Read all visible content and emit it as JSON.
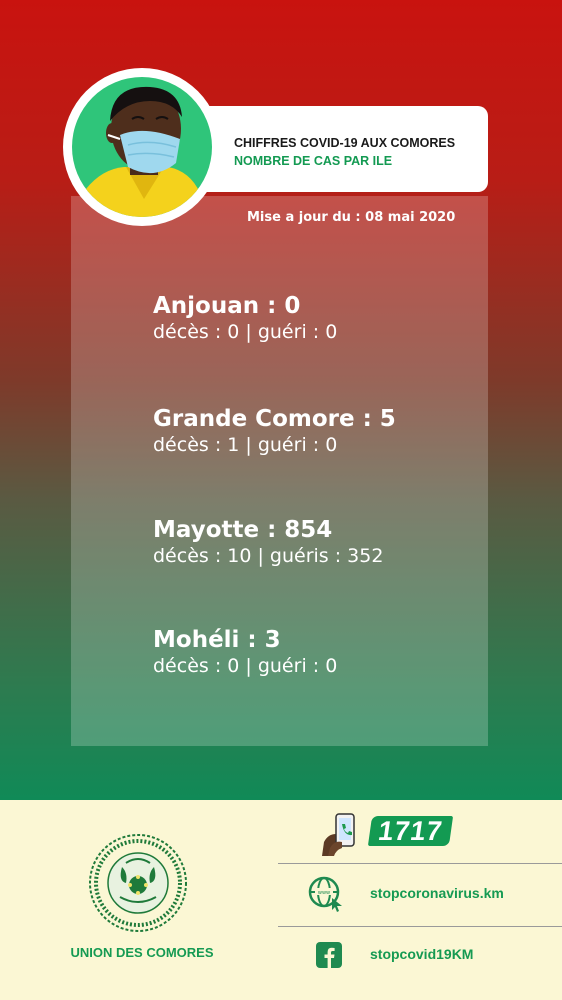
{
  "header": {
    "title": "CHIFFRES COVID-19 AUX COMORES",
    "subtitle": "NOMBRE DE CAS PAR ILE"
  },
  "update_text": "Mise a jour du : 08 mai 2020",
  "islands": [
    {
      "name": "Anjouan : 0",
      "details": "décès : 0  | guéri : 0"
    },
    {
      "name": "Grande Comore : 5",
      "details": "décès : 1  | guéri : 0"
    },
    {
      "name": "Mayotte : 854",
      "details": "décès : 10  | guéris : 352"
    },
    {
      "name": "Mohéli : 3",
      "details": "décès : 0  | guéri : 0"
    }
  ],
  "footer": {
    "org_name": "UNION DES COMORES",
    "seal_text": "UNION DES COMORES",
    "hotline": "1717",
    "website": "stopcoronavirus.km",
    "facebook": "stopcovid19KM"
  },
  "colors": {
    "top_red": "#c9130f",
    "bottom_green": "#108a57",
    "accent_green": "#139a52",
    "footer_bg": "#fbf7d4"
  },
  "icons": [
    "masked-person-illustration",
    "phone-hand-icon",
    "globe-cursor-icon",
    "facebook-icon",
    "union-des-comores-seal"
  ]
}
